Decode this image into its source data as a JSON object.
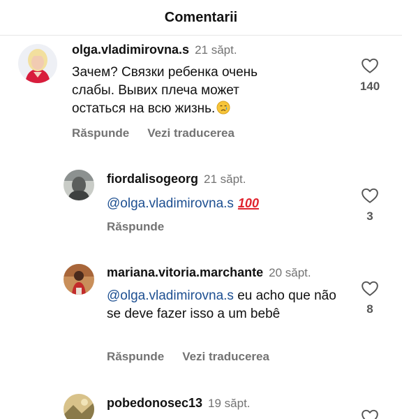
{
  "header": {
    "title": "Comentarii"
  },
  "comments": [
    {
      "username": "olga.vladimirovna.s",
      "time": "21 săpt.",
      "text": "Зачем? Связки ребенка очень слабы. Вывих плеча может остаться на всю жизнь.",
      "emoji": "crying-face-icon",
      "reply_label": "Răspunde",
      "translate_label": "Vezi traducerea",
      "likes": "140"
    },
    {
      "username": "fiordalisogeorg",
      "time": "21 săpt.",
      "mention": "@olga.vladimirovna.s",
      "text": "",
      "emoji_text": "100",
      "reply_label": "Răspunde",
      "likes": "3"
    },
    {
      "username": "mariana.vitoria.marchante",
      "time": "20 săpt.",
      "mention": "@olga.vladimirovna.s",
      "text": " eu acho que não se deve fazer isso a um bebê",
      "reply_label": "Răspunde",
      "translate_label": "Vezi traducerea",
      "likes": "8"
    },
    {
      "username": "pobedonosec13",
      "time": "19 săpt."
    }
  ],
  "colors": {
    "time_gray": "#737373",
    "mention_blue": "#1d4f91",
    "emoji_red": "#e0232e"
  }
}
